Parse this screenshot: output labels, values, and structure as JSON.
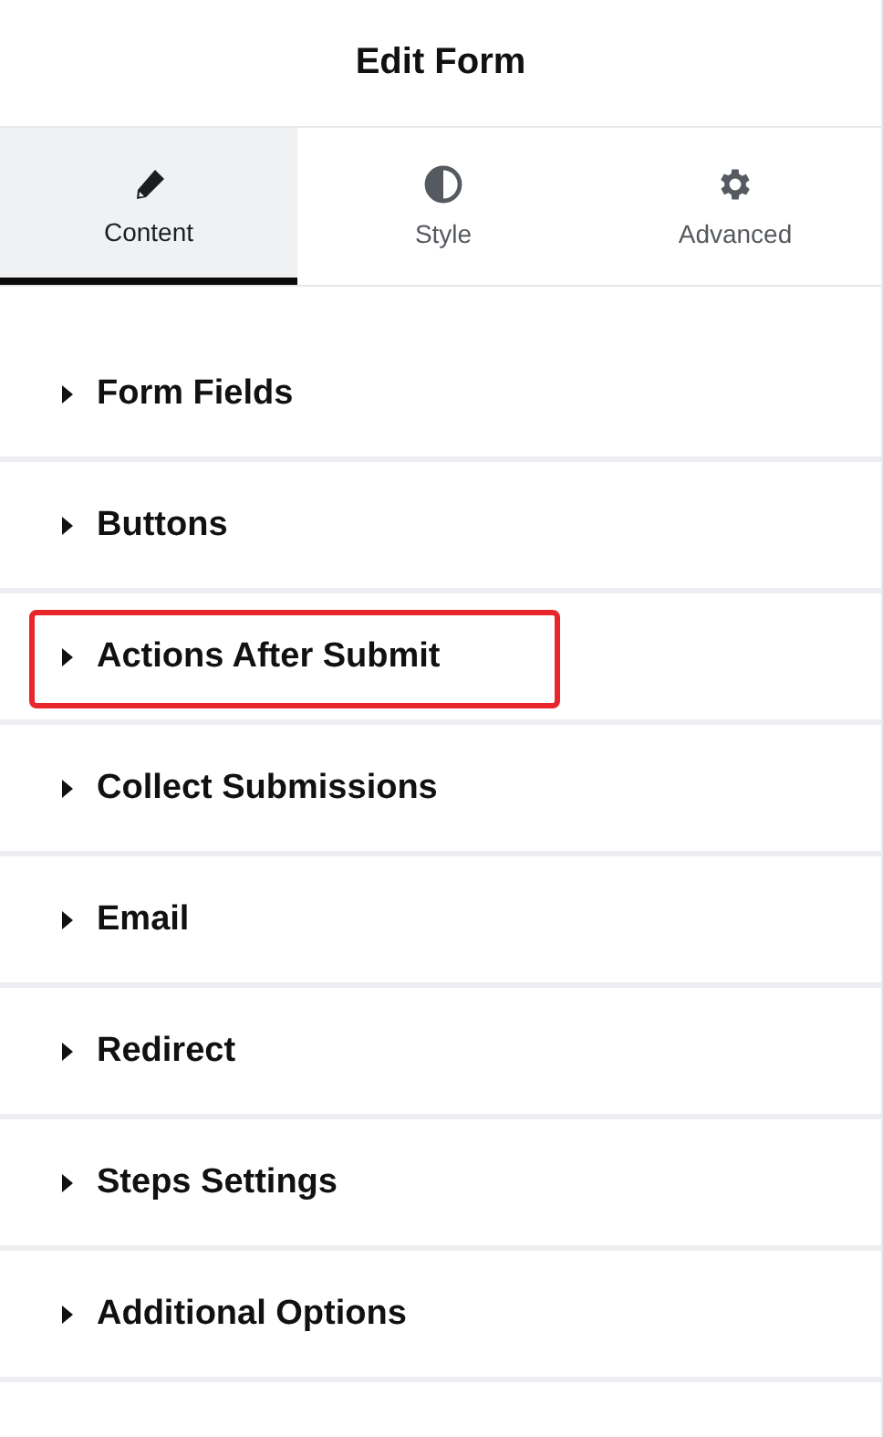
{
  "header": {
    "title": "Edit Form"
  },
  "tabs": [
    {
      "label": "Content",
      "selected": true
    },
    {
      "label": "Style",
      "selected": false
    },
    {
      "label": "Advanced",
      "selected": false
    }
  ],
  "sections": [
    {
      "label": "Form Fields",
      "expanded": false,
      "highlighted": false
    },
    {
      "label": "Buttons",
      "expanded": false,
      "highlighted": false
    },
    {
      "label": "Actions After Submit",
      "expanded": false,
      "highlighted": true
    },
    {
      "label": "Collect Submissions",
      "expanded": false,
      "highlighted": false
    },
    {
      "label": "Email",
      "expanded": false,
      "highlighted": false
    },
    {
      "label": "Redirect",
      "expanded": false,
      "highlighted": false
    },
    {
      "label": "Steps Settings",
      "expanded": false,
      "highlighted": false
    },
    {
      "label": "Additional Options",
      "expanded": false,
      "highlighted": false
    }
  ]
}
